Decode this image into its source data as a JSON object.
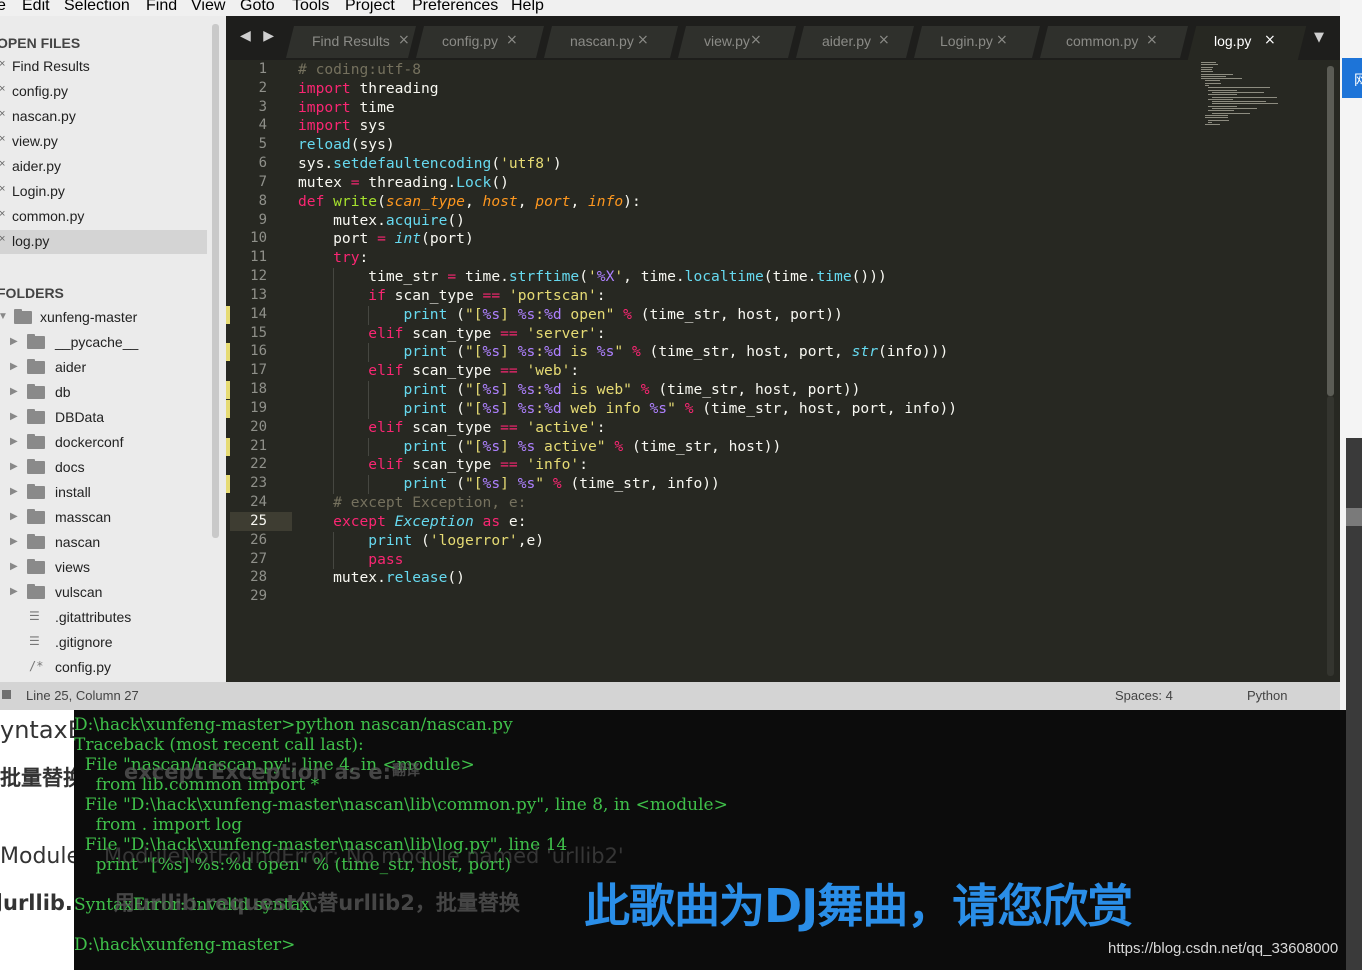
{
  "menu": [
    "e",
    "Edit",
    "Selection",
    "Find",
    "View",
    "Goto",
    "Tools",
    "Project",
    "Preferences",
    "Help"
  ],
  "sidebar": {
    "open_files_header": "OPEN FILES",
    "open_files": [
      "Find Results",
      "config.py",
      "nascan.py",
      "view.py",
      "aider.py",
      "Login.py",
      "common.py",
      "log.py"
    ],
    "close_glyph": "×",
    "folders_header": "FOLDERS",
    "root_folder": "xunfeng-master",
    "folders": [
      "__pycache__",
      "aider",
      "db",
      "DBData",
      "dockerconf",
      "docs",
      "install",
      "masscan",
      "nascan",
      "views",
      "vulscan"
    ],
    "files": [
      {
        "name": ".gitattributes",
        "icon": "text-lines-icon",
        "glyph": "☰"
      },
      {
        "name": ".gitignore",
        "icon": "text-lines-icon",
        "glyph": "☰"
      },
      {
        "name": "config.py",
        "icon": "comment-file-icon",
        "glyph": "/*"
      }
    ]
  },
  "tabs": {
    "nav_arrows": "◀ ▶",
    "items": [
      "Find Results",
      "config.py",
      "nascan.py",
      "view.py",
      "aider.py",
      "Login.py",
      "common.py",
      "log.py"
    ],
    "active": "log.py",
    "close_glyph": "×",
    "dropdown_glyph": "▼"
  },
  "editor": {
    "current_line": 25,
    "modified_lines": [
      14,
      16,
      18,
      19,
      21,
      23
    ],
    "lines": [
      "# coding:utf-8",
      "import threading",
      "import time",
      "import sys",
      "reload(sys)",
      "sys.setdefaultencoding('utf8')",
      "mutex = threading.Lock()",
      "def write(scan_type, host, port, info):",
      "    mutex.acquire()",
      "    port = int(port)",
      "    try:",
      "        time_str = time.strftime('%X', time.localtime(time.time()))",
      "        if scan_type == 'portscan':",
      "            print (\"[%s] %s:%d open\" % (time_str, host, port))",
      "        elif scan_type == 'server':",
      "            print (\"[%s] %s:%d is %s\" % (time_str, host, port, str(info)))",
      "        elif scan_type == 'web':",
      "            print (\"[%s] %s:%d is web\" % (time_str, host, port))",
      "            print (\"[%s] %s:%d web info %s\" % (time_str, host, port, info))",
      "        elif scan_type == 'active':",
      "            print (\"[%s] %s active\" % (time_str, host))",
      "        elif scan_type == 'info':",
      "            print (\"[%s] %s\" % (time_str, info))",
      "    # except Exception, e:",
      "    except Exception as e:",
      "        print ('logerror',e)",
      "        pass",
      "    mutex.release()",
      ""
    ]
  },
  "status": {
    "position": "Line 25, Column 27",
    "spaces": "Spaces: 4",
    "syntax": "Python"
  },
  "right_edge": {
    "blue_char": "网"
  },
  "terminal": {
    "lines": [
      "D:\\hack\\xunfeng-master>python nascan/nascan.py",
      "Traceback (most recent call last):",
      "  File \"nascan/nascan.py\", line 4, in <module>",
      "    from lib.common import *",
      "  File \"D:\\hack\\xunfeng-master\\nascan\\lib\\common.py\", line 8, in <module>",
      "    from . import log",
      "  File \"D:\\hack\\xunfeng-master\\nascan\\lib\\log.py\", line 14",
      "    print \"[%s] %s:%d open\" % (time_str, host, port)",
      "",
      "SyntaxError: invalid syntax",
      "",
      "D:\\hack\\xunfeng-master>"
    ],
    "subtitle": "此歌曲为DJ舞曲，请您欣赏",
    "watermark": "https://blog.csdn.net/qq_33608000",
    "overlay_fragments": {
      "except": "except Exception as e:",
      "translate": "翻译",
      "batch_replace": "批量替换",
      "module_not_found": "ModuleNotFoundError: No module named 'urllib2'",
      "syntax_prefix": "yntaxE",
      "pi_liang": "批量替换成",
      "urllib_text": "用urllib.request代替urllib2，批量替换"
    }
  },
  "colors": {
    "editor_bg": "#272822",
    "keyword": "#f92672",
    "string": "#e6db74",
    "comment": "#75715e",
    "function": "#66d9ef",
    "param": "#fd971f",
    "terminal_text": "#3fc04a",
    "subtitle": "#2a8ee8"
  }
}
